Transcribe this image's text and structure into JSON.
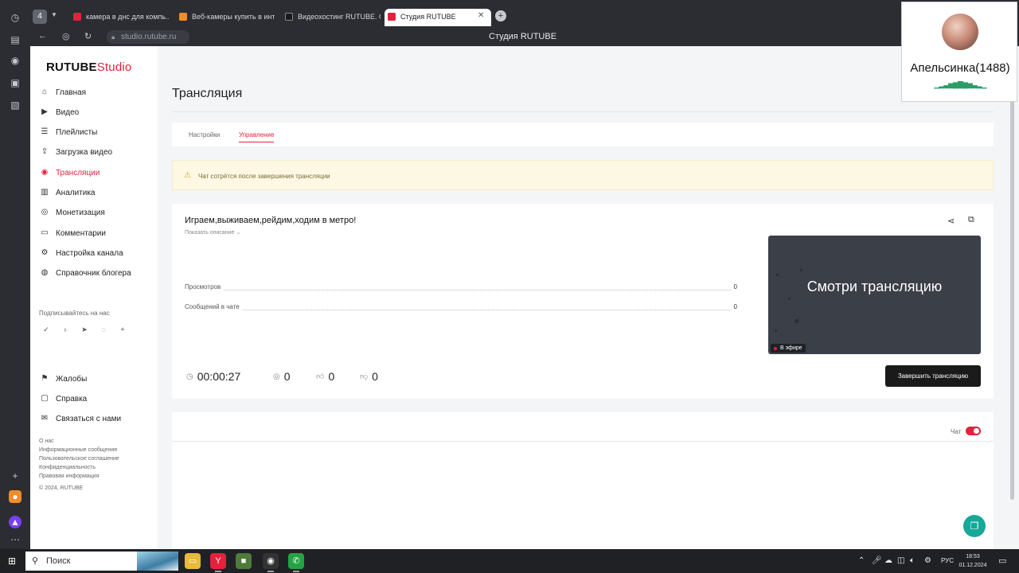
{
  "browser": {
    "tab_count": "4",
    "tabs": [
      {
        "label": "камера в днс для компь...",
        "color": "#e5213c"
      },
      {
        "label": "Веб-камеры купить в инт...",
        "color": "#f28c28"
      },
      {
        "label": "Видеохостинг RUTUBE. С...",
        "color": "#1a1a1a"
      },
      {
        "label": "Студия RUTUBE",
        "color": "#e5213c"
      }
    ],
    "address": "studio.rutube.ru",
    "page_title": "Студия RUTUBE"
  },
  "sidebar": {
    "logo_main": "RUTUBE",
    "logo_sub": "Studio",
    "nav": [
      {
        "label": "Главная",
        "icon": "home-icon"
      },
      {
        "label": "Видео",
        "icon": "video-icon"
      },
      {
        "label": "Плейлисты",
        "icon": "playlist-icon"
      },
      {
        "label": "Загрузка видео",
        "icon": "upload-icon"
      },
      {
        "label": "Трансляции",
        "icon": "broadcast-icon"
      },
      {
        "label": "Аналитика",
        "icon": "analytics-icon"
      },
      {
        "label": "Монетизация",
        "icon": "monetization-icon"
      },
      {
        "label": "Комментарии",
        "icon": "comments-icon"
      },
      {
        "label": "Настройка канала",
        "icon": "gear-icon"
      },
      {
        "label": "Справочник блогера",
        "icon": "book-icon"
      }
    ],
    "subscribe_title": "Подписывайтесь на нас",
    "secondary": [
      {
        "label": "Жалобы",
        "icon": "flag-icon"
      },
      {
        "label": "Справка",
        "icon": "help-icon"
      },
      {
        "label": "Связаться с нами",
        "icon": "mail-icon"
      }
    ],
    "footer_links": [
      "О нас",
      "Информационные сообщения",
      "Пользовательское соглашение",
      "Конфиденциальность",
      "Правовая информация",
      "© 2024, RUTUBE"
    ]
  },
  "main": {
    "title": "Трансляция",
    "tabs": [
      "Настройки",
      "Управление"
    ],
    "warning": "Чат сотрётся после завершения трансляции",
    "stream": {
      "title": "Играем,выживаем,рейдим,ходим в метро!",
      "show_description": "Показать описание",
      "stats": [
        {
          "label": "Просмотров",
          "value": "0"
        },
        {
          "label": "Сообщений в чате",
          "value": "0"
        }
      ],
      "preview_text": "Смотри трансляцию",
      "live_badge": "В эфире",
      "stop_button": "Завершить трансляцию",
      "timer": "00:00:27",
      "viewers": "0",
      "likes": "0",
      "dislikes": "0"
    },
    "chat_label": "Чат"
  },
  "webcam": {
    "name": "Апельсинка(1488)"
  },
  "taskbar": {
    "search_placeholder": "Поиск",
    "lang": "РУС",
    "time": "18:53",
    "date": "01.12.2024"
  },
  "colors": {
    "accent": "#e5213c",
    "help_fab": "#17a89a"
  }
}
